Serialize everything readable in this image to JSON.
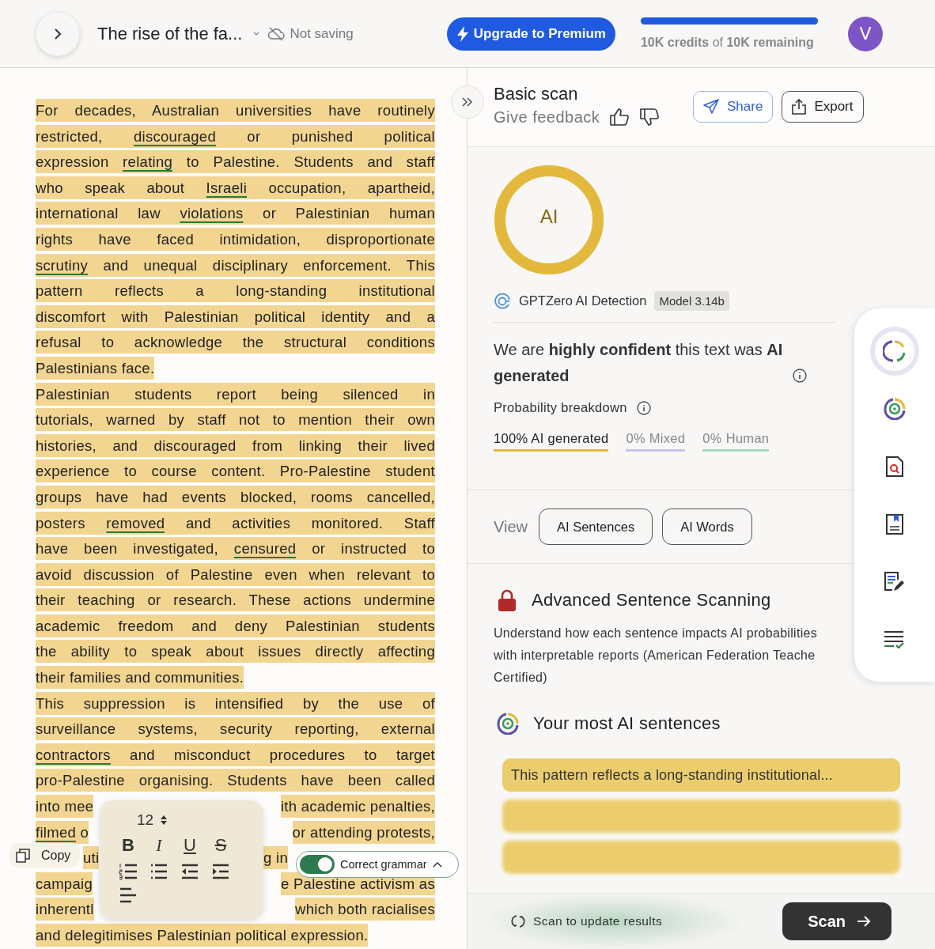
{
  "topbar": {
    "title": "The rise of the fa...",
    "save_status": "Not saving",
    "upgrade_button": "Upgrade to Premium",
    "credits": {
      "level": 1,
      "text": "**10K credits** of **10K remaining**"
    },
    "avatar": "V"
  },
  "document": {
    "lines": [
      {
        "kind": "full",
        "segments": [
          {
            "text": "For decades, Australian universities have routinely",
            "underlined": false
          }
        ]
      },
      {
        "kind": "full",
        "segments": [
          {
            "text": "restricted, ",
            "underlined": false
          },
          {
            "text": "discouraged",
            "underlined": true
          },
          {
            "text": " or punished political",
            "underlined": false
          }
        ]
      },
      {
        "kind": "full",
        "segments": [
          {
            "text": "expression ",
            "underlined": false
          },
          {
            "text": "relating",
            "underlined": true
          },
          {
            "text": " to Palestine. Students and staff",
            "underlined": false
          }
        ]
      },
      {
        "kind": "full",
        "segments": [
          {
            "text": "who speak about ",
            "underlined": false
          },
          {
            "text": "Israeli",
            "underlined": true
          },
          {
            "text": " occupation, apartheid,",
            "underlined": false
          }
        ]
      },
      {
        "kind": "full",
        "segments": [
          {
            "text": "international law ",
            "underlined": false
          },
          {
            "text": "violations",
            "underlined": true
          },
          {
            "text": " or Palestinian human",
            "underlined": false
          }
        ]
      },
      {
        "kind": "full",
        "segments": [
          {
            "text": "rights have faced intimidation, disproportionate",
            "underlined": false
          }
        ]
      },
      {
        "kind": "full",
        "segments": [
          {
            "text": "scrutiny",
            "underlined": true
          },
          {
            "text": " and unequal disciplinary enforcement. This",
            "underlined": false
          }
        ]
      },
      {
        "kind": "full",
        "segments": [
          {
            "text": "pattern reflects a long-standing institutional",
            "underlined": false
          }
        ]
      },
      {
        "kind": "full",
        "segments": [
          {
            "text": "discomfort with Palestinian political identity and a",
            "underlined": false
          }
        ]
      },
      {
        "kind": "full",
        "segments": [
          {
            "text": "refusal to acknowledge the structural conditions",
            "underlined": false
          }
        ]
      },
      {
        "kind": "last",
        "segments": [
          {
            "text": "Palestinians face.",
            "underlined": false
          }
        ]
      },
      {
        "kind": "full",
        "segments": [
          {
            "text": "Palestinian students report being silenced in",
            "underlined": false
          }
        ]
      },
      {
        "kind": "full",
        "segments": [
          {
            "text": "tutorials, warned by staff not to mention their own",
            "underlined": false
          }
        ]
      },
      {
        "kind": "full",
        "segments": [
          {
            "text": "histories, and discouraged from linking their lived",
            "underlined": false
          }
        ]
      },
      {
        "kind": "full",
        "segments": [
          {
            "text": "experience to course content. Pro-Palestine student",
            "underlined": false
          }
        ]
      },
      {
        "kind": "full",
        "segments": [
          {
            "text": "groups have had events blocked, rooms cancelled,",
            "underlined": false
          }
        ]
      },
      {
        "kind": "full",
        "segments": [
          {
            "text": "posters ",
            "underlined": false
          },
          {
            "text": "removed",
            "underlined": true
          },
          {
            "text": " and activities monitored. Staff",
            "underlined": false
          }
        ]
      },
      {
        "kind": "full",
        "segments": [
          {
            "text": "have been investigated, ",
            "underlined": false
          },
          {
            "text": "censured",
            "underlined": true
          },
          {
            "text": " or instructed to",
            "underlined": false
          }
        ]
      },
      {
        "kind": "full",
        "segments": [
          {
            "text": "avoid discussion of Palestine even when relevant to",
            "underlined": false
          }
        ]
      },
      {
        "kind": "full",
        "segments": [
          {
            "text": "their teaching or research. These actions undermine",
            "underlined": false
          }
        ]
      },
      {
        "kind": "full",
        "segments": [
          {
            "text": "academic freedom and deny Palestinian students",
            "underlined": false
          }
        ]
      },
      {
        "kind": "full",
        "segments": [
          {
            "text": "the ability to speak about issues directly affecting",
            "underlined": false
          }
        ]
      },
      {
        "kind": "last",
        "segments": [
          {
            "text": "their families and communities.",
            "underlined": false
          }
        ]
      },
      {
        "kind": "full",
        "segments": [
          {
            "text": "This suppression is intensified by the use of",
            "underlined": false
          }
        ]
      },
      {
        "kind": "full",
        "segments": [
          {
            "text": "surveillance systems, security reporting, external",
            "underlined": false
          }
        ]
      },
      {
        "kind": "full",
        "segments": [
          {
            "text": "contractors",
            "underlined": true
          },
          {
            "text": " and misconduct procedures to target",
            "underlined": false
          }
        ]
      },
      {
        "kind": "full",
        "segments": [
          {
            "text": "pro-Palestine organising. Students have been called",
            "underlined": false
          }
        ]
      },
      {
        "kind": "split",
        "segments": [
          {
            "text": "into mee",
            "underlined": false
          },
          {
            "text": "ith academic penalties,",
            "underlined": false
          }
        ]
      },
      {
        "kind": "split",
        "segments": [
          {
            "text": "filmed",
            "underlined": true
          },
          {
            "text": " o",
            "underlined": false
          },
          {
            "text": "or attending protests,",
            "underlined": false
          }
        ]
      },
      {
        "kind": "middle",
        "segments": [
          {
            "text": "uti",
            "underlined": false
          },
          {
            "text": "g in",
            "underlined": false
          }
        ]
      },
      {
        "kind": "split",
        "segments": [
          {
            "text": "campaig",
            "underlined": false
          },
          {
            "text": "e Palestine activism as",
            "underlined": false
          }
        ]
      },
      {
        "kind": "split",
        "segments": [
          {
            "text": "inherentl",
            "underlined": false
          },
          {
            "text": "which both racialises",
            "underlined": false
          }
        ]
      },
      {
        "kind": "last",
        "segments": [
          {
            "text": "and delegitimises Palestinian political expression.",
            "underlined": false
          }
        ]
      }
    ]
  },
  "format_popup": {
    "font_size": "12",
    "buttons": [
      "B",
      "I",
      "U",
      "S"
    ]
  },
  "copy_button": "Copy",
  "grammar_toggle": {
    "label": "Correct grammar",
    "on": true
  },
  "scan_panel": {
    "title": "Basic scan",
    "feedback": "Give feedback",
    "share": "Share",
    "export": "Export",
    "score": {
      "label": "AI",
      "level": 1
    },
    "detector": "GPTZero AI Detection",
    "model": "Model 3.14b",
    "verdict": "We are **highly confident** this text was **AI generated**",
    "breakdown_title": "Probability breakdown",
    "breakdown": [
      {
        "text": "100% AI generated",
        "color": "#e4b83c",
        "dominant": true
      },
      {
        "text": "0% Mixed",
        "color": "#c9c3e6",
        "dominant": false
      },
      {
        "text": "0% Human",
        "color": "#a9d6c2",
        "dominant": false
      }
    ],
    "view_label": "View",
    "view_buttons": [
      "AI Sentences",
      "AI Words"
    ],
    "advanced_title": "Advanced Sentence Scanning",
    "advanced_lines": [
      "Understand how each sentence impacts AI probabilities",
      "with interpretable reports (American Federation Teache",
      "Certified)"
    ],
    "sentences_title": "Your most AI sentences",
    "sentences": [
      {
        "text": "This pattern reflects a long-standing institutional...",
        "blurred": false
      },
      {
        "blurred": true
      },
      {
        "blurred": true
      }
    ],
    "update_hint": "Scan to update results",
    "scan_button": "Scan"
  },
  "rail": [
    {
      "kind": "ai",
      "selected": true
    },
    {
      "kind": "target",
      "selected": false
    },
    {
      "kind": "search",
      "selected": false
    },
    {
      "kind": "bookmark",
      "selected": false
    },
    {
      "kind": "edit",
      "selected": false
    },
    {
      "kind": "check",
      "selected": false
    }
  ]
}
